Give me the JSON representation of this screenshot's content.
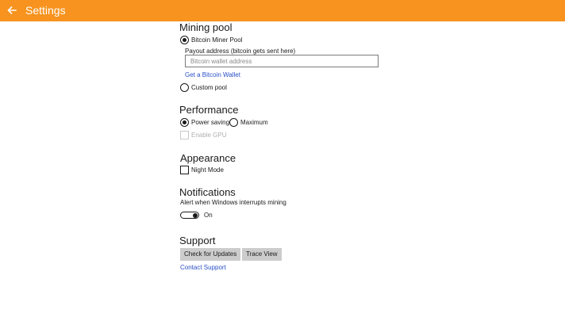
{
  "header": {
    "title": "Settings",
    "back_icon": "back-arrow-icon",
    "background_color": "#f7931e"
  },
  "mining_pool": {
    "title": "Mining pool",
    "option_bitcoin_miner_pool": "Bitcoin Miner Pool",
    "option_bitcoin_miner_pool_selected": true,
    "payout_label": "Payout address (bitcoin gets sent here)",
    "payout_value": "",
    "payout_placeholder": "Bitcoin wallet address",
    "get_wallet_link": "Get a Bitcoin Wallet",
    "option_custom_pool": "Custom pool",
    "option_custom_pool_selected": false
  },
  "performance": {
    "title": "Performance",
    "option_power_saving": "Power saving",
    "option_power_saving_selected": true,
    "option_maximum": "Maximum",
    "option_maximum_selected": false,
    "enable_gpu_label": "Enable GPU",
    "enable_gpu_checked": false,
    "enable_gpu_disabled": true
  },
  "appearance": {
    "title": "Appearance",
    "night_mode_label": "Night Mode",
    "night_mode_checked": false
  },
  "notifications": {
    "title": "Notifications",
    "alert_label": "Alert when Windows interrupts mining",
    "toggle_state": "On",
    "toggle_on": true
  },
  "support": {
    "title": "Support",
    "check_updates_button": "Check for Updates",
    "trace_view_button": "Trace View",
    "contact_link": "Contact Support"
  },
  "colors": {
    "accent": "#f7931e",
    "link": "#2a50c7",
    "button_bg": "#cccccc"
  }
}
